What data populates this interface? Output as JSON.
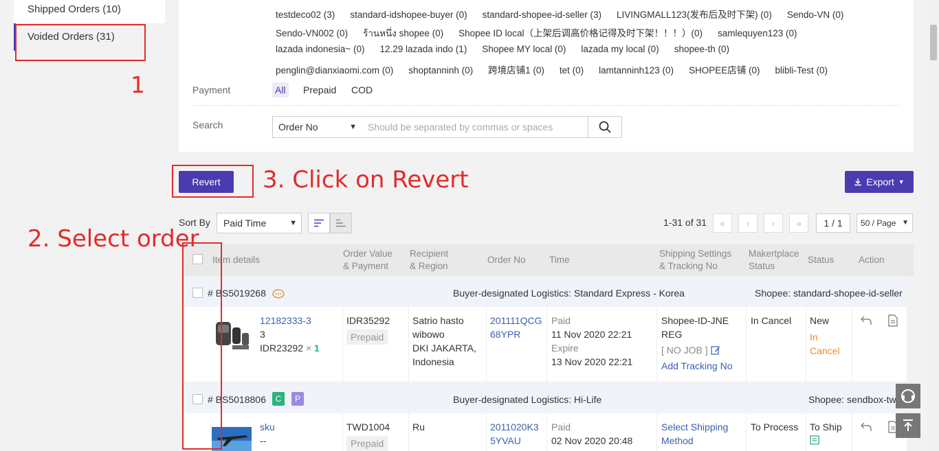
{
  "sidebar": {
    "shipped": "Shipped Orders (10)",
    "voided": "Voided Orders (31)"
  },
  "stores": {
    "row1": [
      "testdeco02 (3)",
      "standard-idshopee-buyer (0)",
      "standard-shopee-id-seller (3)",
      "LIVINGMALL123(发布后及时下架) (0)",
      "Sendo-VN (0)"
    ],
    "row2": [
      "Sendo-VN002 (0)",
      "ร้านหนึ่ง shopee (0)",
      "Shopee ID local（上架后调高价格记得及时下架！！！）(0)",
      "samlequyen123 (0)"
    ],
    "row3": [
      "lazada indonesia~ (0)",
      "12.29 lazada indo (1)",
      "Shopee MY local (0)",
      "lazada my local (0)",
      "shopee-th (0)"
    ],
    "row4": [
      "penglin@dianxiaomi.com (0)",
      "shoptanninh (0)",
      "跨境店铺1 (0)",
      "tet (0)",
      "lamtanninh123 (0)",
      "SHOPEE店铺 (0)",
      "blibli-Test (0)"
    ]
  },
  "filters": {
    "payment_label": "Payment",
    "payment_options": [
      "All",
      "Prepaid",
      "COD"
    ],
    "search_label": "Search",
    "search_field": "Order No",
    "search_placeholder": "Should be separated by commas or spaces"
  },
  "toolbar": {
    "revert": "Revert",
    "export": "Export",
    "sort_label": "Sort By",
    "sort_value": "Paid Time",
    "pager_info": "1-31 of 31",
    "page": "1 / 1",
    "per_page": "50 / Page"
  },
  "annotations": {
    "step1": "1",
    "step2": "2. Select order",
    "step3": "3. Click on Revert"
  },
  "table": {
    "headers": {
      "item": "Item details",
      "value_l1": "Order Value",
      "value_l2": "& Payment",
      "recipient_l1": "Recipient",
      "recipient_l2": "& Region",
      "order_no": "Order No",
      "time": "Time",
      "shipping_l1": "Shipping Settings",
      "shipping_l2": "& Tracking No",
      "market_l1": "Makertplace",
      "market_l2": "Status",
      "status": "Status",
      "action": "Action"
    },
    "orders": [
      {
        "id": "# BS5019268",
        "logistics": "Buyer-designated Logistics: Standard Express - Korea",
        "shop": "Shopee: standard-shopee-id-seller",
        "sku": "12182333-3",
        "sku_line2": "3",
        "price": "IDR23292",
        "qty_sep": "×",
        "qty": "1",
        "value": "IDR35292",
        "payment": "Prepaid",
        "recipient": [
          "Satrio hasto",
          "wibowo",
          "DKI JAKARTA,",
          "Indonesia"
        ],
        "order_no": [
          "201111QCG",
          "68YPR"
        ],
        "paid_label": "Paid",
        "paid_time": "11 Nov 2020 22:21",
        "expire_label": "Expire",
        "expire_time": "13 Nov 2020 22:21",
        "shipping": [
          "Shopee-ID-JNE",
          "REG"
        ],
        "job": "[ NO JOB ]",
        "add_tracking": "Add Tracking No",
        "market_status": "In Cancel",
        "status": "New",
        "status2": [
          "In",
          "Cancel"
        ]
      },
      {
        "id": "# BS5018806",
        "tags": [
          "C",
          "P"
        ],
        "logistics": "Buyer-designated Logistics: Hi-Life",
        "shop": "Shopee: sendbox-tw",
        "sku": "sku",
        "sku_line2": "--",
        "value": "TWD1004",
        "payment": "Prepaid",
        "recipient": [
          "Ru"
        ],
        "order_no": [
          "2011020K3",
          "5YVAU"
        ],
        "paid_label": "Paid",
        "paid_time": "02 Nov 2020 20:48",
        "shipping": [
          "Select Shipping",
          "Method"
        ],
        "market_status": "To Process",
        "status": "To Ship"
      }
    ]
  }
}
